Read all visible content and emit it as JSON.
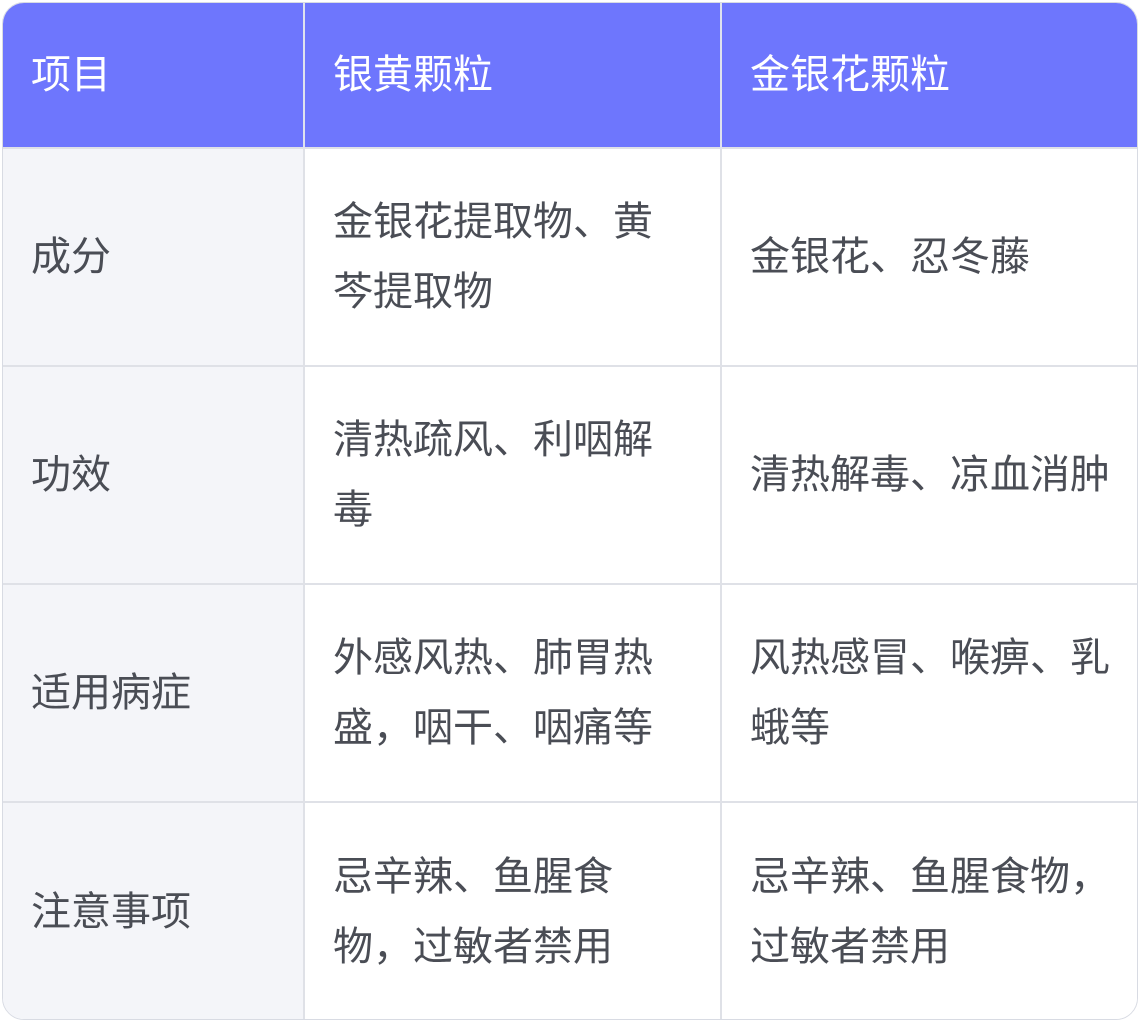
{
  "header": {
    "col1": "项目",
    "col2": "银黄颗粒",
    "col3": "金银花颗粒"
  },
  "rows": [
    {
      "label": "成分",
      "yinhuang": "金银花提取物、黄芩提取物",
      "jinyinhua": "金银花、忍冬藤"
    },
    {
      "label": "功效",
      "yinhuang": "清热疏风、利咽解毒",
      "jinyinhua": "清热解毒、凉血消肿"
    },
    {
      "label": "适用病症",
      "yinhuang": "外感风热、肺胃热盛，咽干、咽痛等",
      "jinyinhua": "风热感冒、喉痹、乳蛾等"
    },
    {
      "label": "注意事项",
      "yinhuang": "忌辛辣、鱼腥食物，过敏者禁用",
      "jinyinhua": "忌辛辣、鱼腥食物，过敏者禁用"
    }
  ],
  "colors": {
    "header_bg": "#6e76fd",
    "header_text": "#ffffff",
    "label_bg": "#f4f5f9",
    "body_text": "#4a4d55",
    "border": "#dfe1e7"
  }
}
